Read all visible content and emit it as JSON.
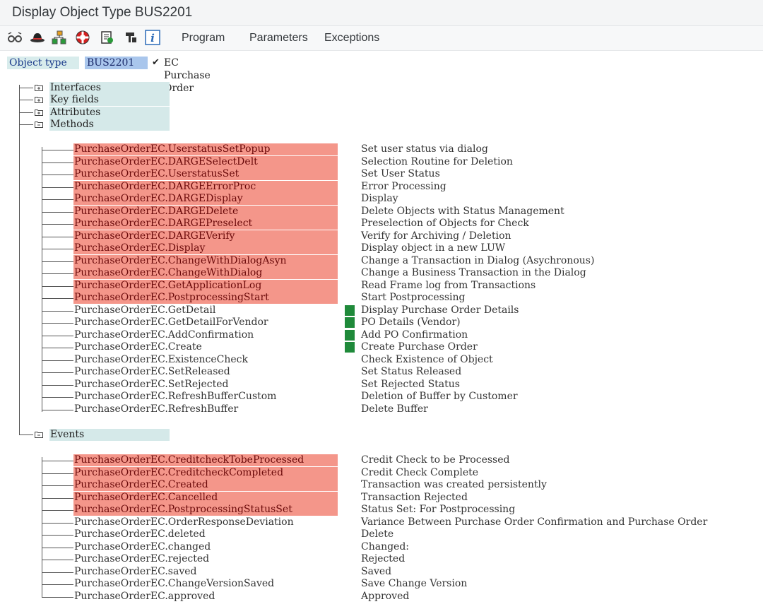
{
  "window": {
    "title": "Display Object Type BUS2201"
  },
  "toolbar": {
    "icons": [
      "glasses-icon",
      "hat-icon",
      "hierarchy-icon",
      "lifebuoy-icon",
      "document-list-icon",
      "lock-icon",
      "info-icon"
    ],
    "menu": [
      "Program",
      "Parameters",
      "Exceptions"
    ]
  },
  "object": {
    "label": "Object type",
    "value": "BUS2201",
    "check": "✔",
    "description": "EC Purchase Order"
  },
  "folders": {
    "interfaces": "Interfaces",
    "key_fields": "Key fields",
    "attributes": "Attributes",
    "methods": "Methods",
    "events": "Events"
  },
  "methods": [
    {
      "name": "PurchaseOrderEC.UserstatusSetPopup",
      "desc": "Set user status via dialog",
      "red": true,
      "mark": false
    },
    {
      "name": "PurchaseOrderEC.DARGESelectDelt",
      "desc": "Selection Routine for Deletion",
      "red": true,
      "mark": false
    },
    {
      "name": "PurchaseOrderEC.UserstatusSet",
      "desc": "Set User Status",
      "red": true,
      "mark": false
    },
    {
      "name": "PurchaseOrderEC.DARGEErrorProc",
      "desc": "Error Processing",
      "red": true,
      "mark": false
    },
    {
      "name": "PurchaseOrderEC.DARGEDisplay",
      "desc": "Display",
      "red": true,
      "mark": false
    },
    {
      "name": "PurchaseOrderEC.DARGEDelete",
      "desc": "Delete Objects with Status Management",
      "red": true,
      "mark": false
    },
    {
      "name": "PurchaseOrderEC.DARGEPreselect",
      "desc": "Preselection of Objects for Check",
      "red": true,
      "mark": false
    },
    {
      "name": "PurchaseOrderEC.DARGEVerify",
      "desc": "Verify for Archiving / Deletion",
      "red": true,
      "mark": false
    },
    {
      "name": "PurchaseOrderEC.Display",
      "desc": "Display object in a new LUW",
      "red": true,
      "mark": false
    },
    {
      "name": "PurchaseOrderEC.ChangeWithDialogAsyn",
      "desc": "Change a Transaction in Dialog (Asychronous)",
      "red": true,
      "mark": false
    },
    {
      "name": "PurchaseOrderEC.ChangeWithDialog",
      "desc": "Change a Business Transaction in the Dialog",
      "red": true,
      "mark": false
    },
    {
      "name": "PurchaseOrderEC.GetApplicationLog",
      "desc": "Read Frame log from Transactions",
      "red": true,
      "mark": false
    },
    {
      "name": "PurchaseOrderEC.PostprocessingStart",
      "desc": "Start Postprocessing",
      "red": true,
      "mark": false
    },
    {
      "name": "PurchaseOrderEC.GetDetail",
      "desc": "Display Purchase Order Details",
      "red": false,
      "mark": true
    },
    {
      "name": "PurchaseOrderEC.GetDetailForVendor",
      "desc": "PO Details (Vendor)",
      "red": false,
      "mark": true
    },
    {
      "name": "PurchaseOrderEC.AddConfirmation",
      "desc": "Add PO Confirmation",
      "red": false,
      "mark": true
    },
    {
      "name": "PurchaseOrderEC.Create",
      "desc": "Create Purchase Order",
      "red": false,
      "mark": true
    },
    {
      "name": "PurchaseOrderEC.ExistenceCheck",
      "desc": "Check Existence of Object",
      "red": false,
      "mark": false
    },
    {
      "name": "PurchaseOrderEC.SetReleased",
      "desc": "Set Status Released",
      "red": false,
      "mark": false
    },
    {
      "name": "PurchaseOrderEC.SetRejected",
      "desc": "Set Rejected Status",
      "red": false,
      "mark": false
    },
    {
      "name": "PurchaseOrderEC.RefreshBufferCustom",
      "desc": "Deletion of Buffer by Customer",
      "red": false,
      "mark": false
    },
    {
      "name": "PurchaseOrderEC.RefreshBuffer",
      "desc": "Delete Buffer",
      "red": false,
      "mark": false
    }
  ],
  "events": [
    {
      "name": "PurchaseOrderEC.CreditcheckTobeProcessed",
      "desc": "Credit Check to be Processed",
      "red": true
    },
    {
      "name": "PurchaseOrderEC.CreditcheckCompleted",
      "desc": "Credit Check Complete",
      "red": true
    },
    {
      "name": "PurchaseOrderEC.Created",
      "desc": "Transaction was created persistently",
      "red": true
    },
    {
      "name": "PurchaseOrderEC.Cancelled",
      "desc": "Transaction Rejected",
      "red": true
    },
    {
      "name": "PurchaseOrderEC.PostprocessingStatusSet",
      "desc": "Status Set: For Postprocessing",
      "red": true
    },
    {
      "name": "PurchaseOrderEC.OrderResponseDeviation",
      "desc": "Variance Between Purchase Order Confirmation and Purchase Order",
      "red": false
    },
    {
      "name": "PurchaseOrderEC.deleted",
      "desc": "Delete",
      "red": false
    },
    {
      "name": "PurchaseOrderEC.changed",
      "desc": "Changed:",
      "red": false
    },
    {
      "name": "PurchaseOrderEC.rejected",
      "desc": "Rejected",
      "red": false
    },
    {
      "name": "PurchaseOrderEC.saved",
      "desc": "Saved",
      "red": false
    },
    {
      "name": "PurchaseOrderEC.ChangeVersionSaved",
      "desc": "Save Change Version",
      "red": false
    },
    {
      "name": "PurchaseOrderEC.approved",
      "desc": "Approved",
      "red": false
    }
  ],
  "colors": {
    "highlight_red": "#f4968a",
    "folder_bg": "#d5e9e9",
    "status_green": "#1f8a3a",
    "selected_value": "#a9c6ec"
  }
}
